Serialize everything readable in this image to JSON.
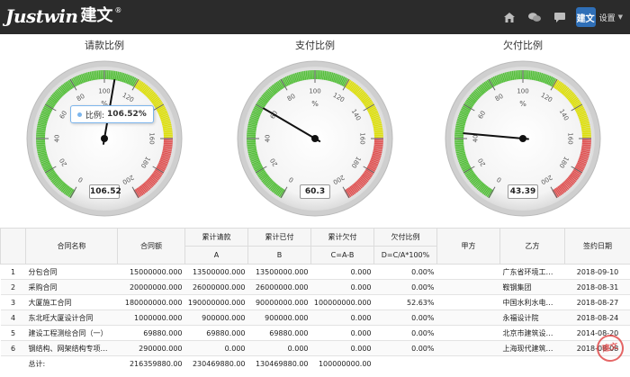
{
  "header": {
    "logo_en": "Justwin",
    "logo_cn": "建文",
    "logo_reg": "®",
    "user_badge": "建文",
    "settings_label": "设置",
    "icons": [
      "home-icon",
      "chat-icon",
      "message-icon"
    ]
  },
  "gauges": [
    {
      "title": "请款比例",
      "value": 106.52,
      "display": "106.52",
      "unit": "%",
      "min": 0,
      "max": 200,
      "tooltip_label": "比例:",
      "tooltip_value": "106.52%"
    },
    {
      "title": "支付比例",
      "value": 60.3,
      "display": "60.3",
      "unit": "%",
      "min": 0,
      "max": 200
    },
    {
      "title": "欠付比例",
      "value": 43.39,
      "display": "43.39",
      "unit": "%",
      "min": 0,
      "max": 200
    }
  ],
  "gauge_ticks": [
    "0",
    "20",
    "40",
    "60",
    "80",
    "100",
    "120",
    "140",
    "160",
    "180",
    "200"
  ],
  "colors": {
    "header_bg": "#2b2b2b",
    "band_green": "#55bf3b",
    "band_yellow": "#dddf0d",
    "band_red": "#df5353",
    "tooltip_border": "#7cb5ec"
  },
  "table": {
    "headers": {
      "contract_name": "合同名称",
      "contract_amount": "合同额",
      "cum_request": "累计请款",
      "cum_request_sub": "A",
      "cum_paid": "累计已付",
      "cum_paid_sub": "B",
      "cum_owed": "累计欠付",
      "cum_owed_sub": "C=A-B",
      "owed_ratio": "欠付比例",
      "owed_ratio_sub": "D=C/A*100%",
      "party_a": "甲方",
      "party_b": "乙方",
      "sign_date": "签约日期"
    },
    "rows": [
      {
        "idx": "1",
        "name": "分包合同",
        "amount": "15000000.000",
        "request": "13500000.000",
        "paid": "13500000.000",
        "owed": "0.000",
        "ratio": "0.00%",
        "party_a": "",
        "party_b": "广东省环境工…",
        "date": "2018-09-10"
      },
      {
        "idx": "2",
        "name": "采购合同",
        "amount": "20000000.000",
        "request": "26000000.000",
        "paid": "26000000.000",
        "owed": "0.000",
        "ratio": "0.00%",
        "party_a": "",
        "party_b": "鞍钢集团",
        "date": "2018-08-31"
      },
      {
        "idx": "3",
        "name": "大厦施工合同",
        "amount": "180000000.000",
        "request": "190000000.000",
        "paid": "90000000.000",
        "owed": "100000000.000",
        "ratio": "52.63%",
        "party_a": "",
        "party_b": "中国水利水电…",
        "date": "2018-08-27"
      },
      {
        "idx": "4",
        "name": "东北旺大厦设计合同",
        "amount": "1000000.000",
        "request": "900000.000",
        "paid": "900000.000",
        "owed": "0.000",
        "ratio": "0.00%",
        "party_a": "",
        "party_b": "永福设计院",
        "date": "2018-08-24"
      },
      {
        "idx": "5",
        "name": "建设工程测绘合同（一）",
        "amount": "69880.000",
        "request": "69880.000",
        "paid": "69880.000",
        "owed": "0.000",
        "ratio": "0.00%",
        "party_a": "",
        "party_b": "北京市建筑设…",
        "date": "2014-08-20"
      },
      {
        "idx": "6",
        "name": "钢结构、网架结构专项…",
        "amount": "290000.000",
        "request": "0.000",
        "paid": "0.000",
        "owed": "0.000",
        "ratio": "0.00%",
        "party_a": "",
        "party_b": "上海现代建筑…",
        "date": "2018-08-08"
      }
    ],
    "total": {
      "label": "总计:",
      "amount": "216359880.00",
      "request": "230469880.00",
      "paid": "130469880.00",
      "owed": "100000000.00"
    }
  }
}
